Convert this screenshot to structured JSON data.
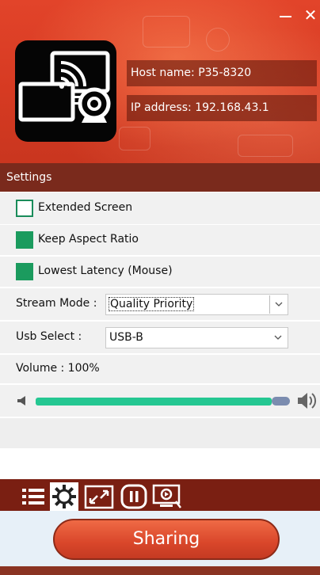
{
  "header": {
    "host_name": "Host name: P35-8320",
    "ip_address": "IP address: 192.168.43.1",
    "minimize_glyph": "",
    "close_glyph": "✕"
  },
  "settings": {
    "title": "Settings",
    "extended_screen": {
      "label": "Extended Screen",
      "checked": false
    },
    "keep_aspect": {
      "label": "Keep Aspect Ratio",
      "checked": true
    },
    "lowest_latency": {
      "label": "Lowest Latency  (Mouse)",
      "checked": true
    },
    "stream_mode": {
      "label": "Stream Mode :",
      "value": "Quality Priority"
    },
    "usb_select": {
      "label": "Usb Select :",
      "value": "USB-B"
    },
    "volume": {
      "label": "Volume  : 100%",
      "level_percent": 100
    }
  },
  "toolbar": {
    "icons": [
      "list-icon",
      "gear-icon",
      "resize-icon",
      "pause-icon",
      "cast-icon"
    ],
    "active": "gear-icon"
  },
  "share": {
    "label": "Sharing"
  },
  "colors": {
    "accent_red": "#d63a22",
    "dark_red": "#7a2a1c",
    "green": "#1b9b5e",
    "slider": "#25c792"
  }
}
